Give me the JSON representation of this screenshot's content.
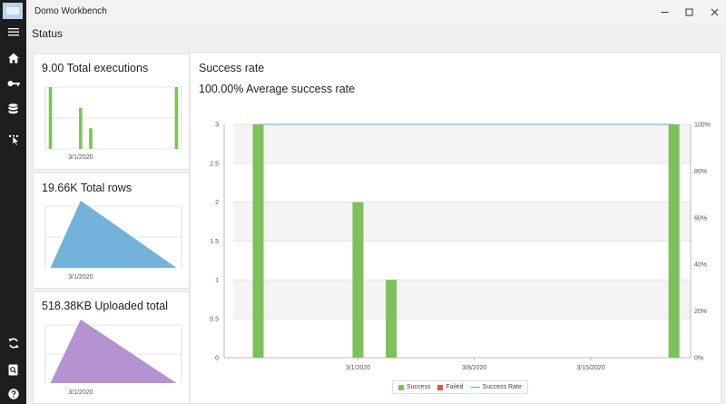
{
  "window": {
    "app_title": "Domo Workbench",
    "controls": [
      "minimize-icon",
      "maximize-icon",
      "close-icon"
    ]
  },
  "page": {
    "title": "Status"
  },
  "sidebar": {
    "items": [
      {
        "icon": "menu-icon"
      },
      {
        "icon": "home-icon"
      },
      {
        "icon": "key-icon"
      },
      {
        "icon": "database-icon"
      },
      {
        "icon": "more-icon"
      },
      {
        "icon": "sync-icon"
      },
      {
        "icon": "log-search-icon"
      },
      {
        "icon": "help-icon"
      }
    ]
  },
  "cards": {
    "executions": {
      "title": "9.00 Total executions",
      "chart_data": {
        "type": "bar",
        "x": [
          "2020-02-24",
          "2020-03-01",
          "2020-03-03",
          "2020-03-20"
        ],
        "values": [
          3,
          2,
          1,
          3
        ],
        "xticks": [
          "3/1/2020"
        ],
        "color": "#7dc15a"
      }
    },
    "rows": {
      "title": "19.66K Total rows",
      "chart_data": {
        "type": "area",
        "xticks": [
          "3/1/2020"
        ],
        "color": "#6aaed9"
      }
    },
    "uploaded": {
      "title": "518.38KB Uploaded total",
      "chart_data": {
        "type": "area",
        "xticks": [
          "3/1/2020"
        ],
        "color": "#b08dce"
      }
    }
  },
  "success": {
    "title": "Success rate",
    "subtitle": "100.00% Average success rate",
    "chart_data": {
      "type": "bar",
      "x": [
        "2020-02-24",
        "2020-03-01",
        "2020-03-03",
        "2020-03-20"
      ],
      "series": [
        {
          "name": "Success",
          "values": [
            3,
            2,
            1,
            3
          ],
          "color": "#7dc15a"
        },
        {
          "name": "Failed",
          "values": [
            0,
            0,
            0,
            0
          ],
          "color": "#e0544f"
        },
        {
          "name": "Success Rate",
          "values": [
            100,
            100,
            100,
            100
          ],
          "color": "#5aaedc",
          "axis": "right"
        }
      ],
      "ylim": [
        0,
        3
      ],
      "yticks": [
        "0",
        "0.5",
        "1",
        "1.5",
        "2",
        "2.5",
        "3"
      ],
      "y2lim": [
        0,
        100
      ],
      "y2ticks": [
        "0%",
        "20%",
        "40%",
        "60%",
        "80%",
        "100%"
      ],
      "xticks": [
        "3/1/2020",
        "3/8/2020",
        "3/15/2020"
      ],
      "legend_position": "bottom-center",
      "grid": true
    }
  }
}
